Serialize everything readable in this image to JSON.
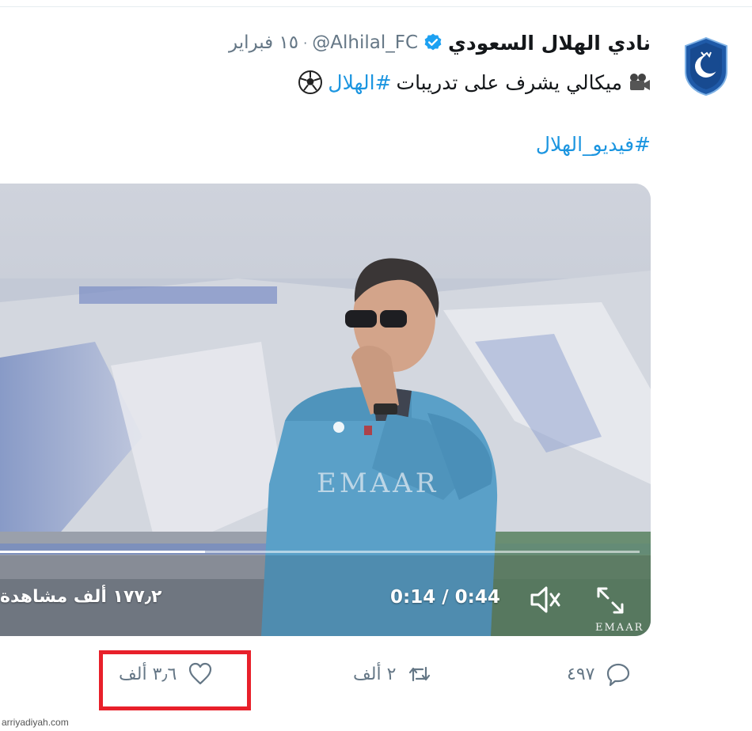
{
  "account": {
    "name": "نادي الهلال السعودي",
    "handle": "@Alhilal_FC",
    "separator": "·",
    "date": "١٥ فبراير"
  },
  "tweet": {
    "text": "ميكالي يشرف على تدريبات",
    "hashtag_inline": "#الهلال",
    "hashtag_line": "#فيديو_الهلال"
  },
  "video": {
    "views": "١٧٧٫٢ ألف مشاهدة",
    "time": "0:14 / 0:44",
    "progress_fraction": 0.32,
    "brand_on_shirt": "EMAAR"
  },
  "actions": {
    "replies": "٤٩٧",
    "retweets": "٢ ألف",
    "likes": "٣٫٦ ألف"
  },
  "watermark": "arriyadiyah.com",
  "colors": {
    "link": "#1b95e0",
    "muted": "#657786",
    "highlight": "#e8202a"
  }
}
